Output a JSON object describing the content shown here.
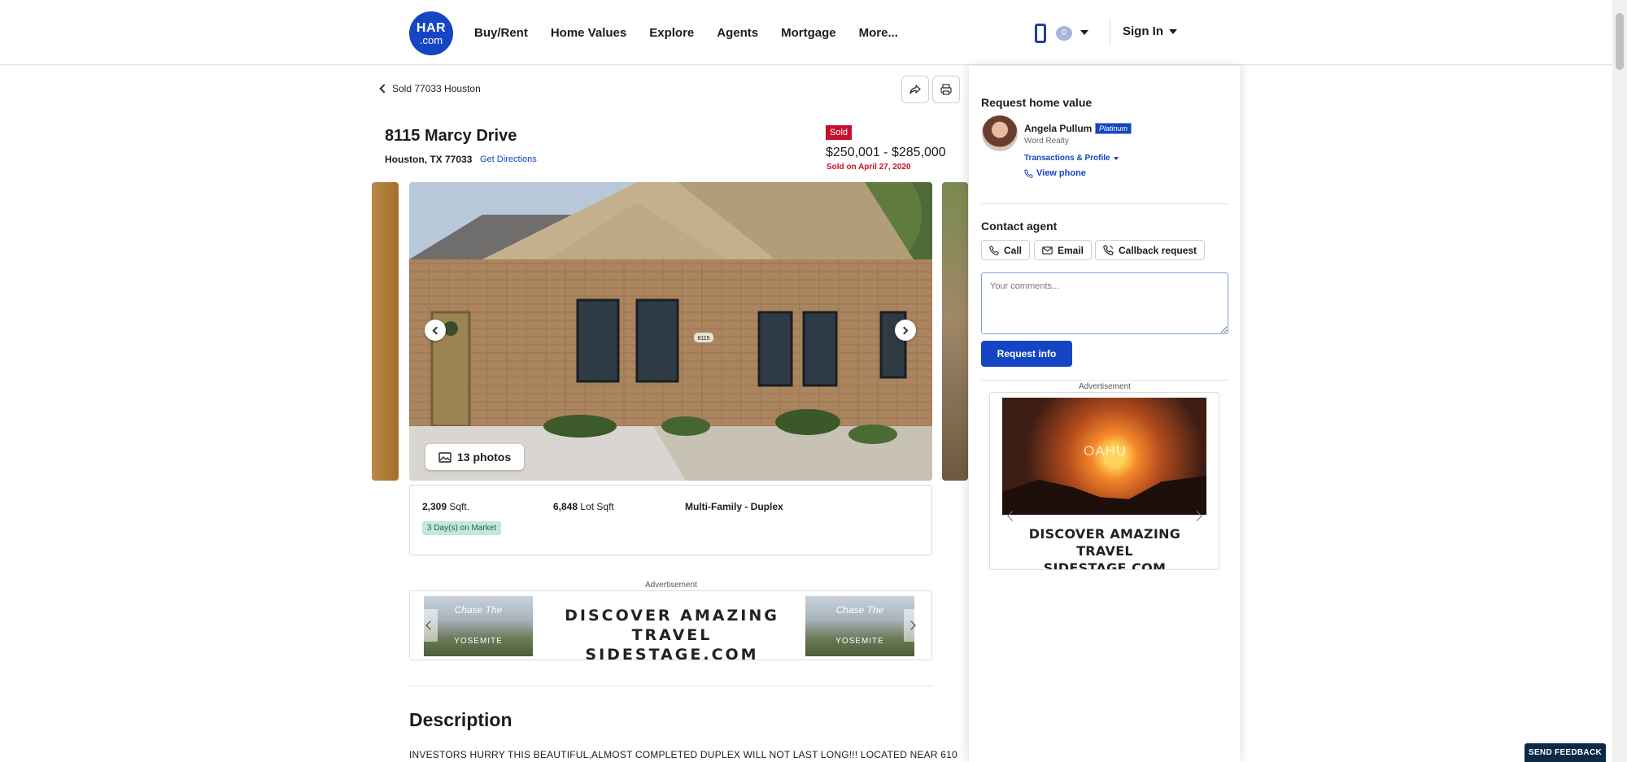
{
  "header": {
    "logo_top": "HAR",
    "logo_bottom": ".com",
    "nav": [
      "Buy/Rent",
      "Home Values",
      "Explore",
      "Agents",
      "Mortgage",
      "More..."
    ],
    "favorites_count": "0",
    "signin_label": "Sign In"
  },
  "listing": {
    "back_label": "Sold 77033 Houston",
    "address": "8115 Marcy Drive",
    "city_zip": "Houston, TX 77033",
    "directions_label": "Get Directions",
    "status_badge": "Sold",
    "price_range": "$250,001 - $285,000",
    "sold_date": "Sold on April 27, 2020",
    "photos_label": "13 photos",
    "house_number": "8115",
    "facts": {
      "sqft_value": "2,309",
      "sqft_unit": "Sqft.",
      "lot_value": "6,848",
      "lot_unit": "Lot Sqft",
      "property_type": "Multi-Family - Duplex",
      "days_on_market": "3 Day(s) on Market"
    }
  },
  "advertisement": {
    "label": "Advertisement",
    "text_line1": "DISCOVER AMAZING TRAVEL",
    "text_line2": "SIDESTAGE.COM",
    "image_script": "Chase The",
    "image_caption": "YOSEMITE"
  },
  "description": {
    "title": "Description",
    "text": "INVESTORS HURRY THIS BEAUTIFUL,ALMOST COMPLETED DUPLEX WILL NOT LAST LONG!!! LOCATED NEAR 610"
  },
  "sidebar": {
    "request_title": "Request home value",
    "agent_name": "Angela Pullum",
    "agent_badge": "Platinum",
    "agent_company": "Word Realty",
    "transactions_label": "Transactions & Profile",
    "view_phone_label": "View phone",
    "contact_title": "Contact agent",
    "buttons": {
      "call": "Call",
      "email": "Email",
      "callback": "Callback request"
    },
    "comments_placeholder": "Your comments...",
    "request_button": "Request info",
    "ad_label": "Advertisement",
    "ad_image_text": "OAHU",
    "ad_line1": "DISCOVER AMAZING TRAVEL",
    "ad_line2": "SIDESTAGE.COM"
  },
  "feedback_label": "SEND FEEDBACK",
  "colors": {
    "brand_blue": "#1446c4",
    "sold_red": "#c8102e",
    "dom_badge": "#bfe8de",
    "feedback_bg": "#0b2a48"
  }
}
